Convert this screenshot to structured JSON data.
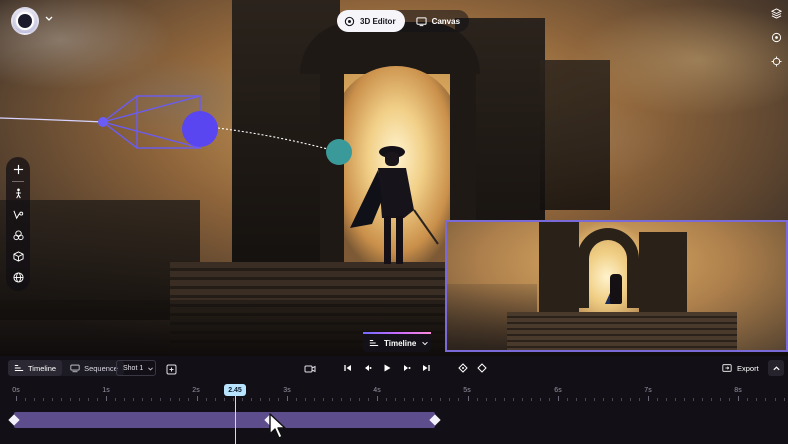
{
  "top_bar": {
    "modes": [
      {
        "label": "3D Editor",
        "icon": "gizmo-icon",
        "active": true
      },
      {
        "label": "Canvas",
        "icon": "monitor-icon",
        "active": false
      }
    ],
    "right_tools": [
      "layers-icon",
      "orbit-icon",
      "crosshair-icon"
    ]
  },
  "left_toolbar": {
    "tools": [
      "add-icon",
      "divider",
      "character-icon",
      "camera-path-icon",
      "objects-icon",
      "cube-icon",
      "globe-icon"
    ]
  },
  "timeline_chip": {
    "label": "Timeline"
  },
  "bottom_bar": {
    "tabs": [
      {
        "label": "Timeline",
        "active": true
      },
      {
        "label": "Sequence",
        "active": false
      }
    ],
    "shot_select": {
      "value": "Shot 1"
    },
    "export_label": "Export"
  },
  "ruler": {
    "labels": [
      "0s",
      "1s",
      "2s",
      "3s",
      "4s",
      "5s",
      "6s",
      "7s",
      "8s"
    ]
  },
  "playhead": {
    "time": "2.45"
  },
  "colors": {
    "accent": "#5d4d8c",
    "rig": "#6a5cf5",
    "node_teal": "#3a9a9a",
    "preview_border": "#7a6ad8"
  }
}
